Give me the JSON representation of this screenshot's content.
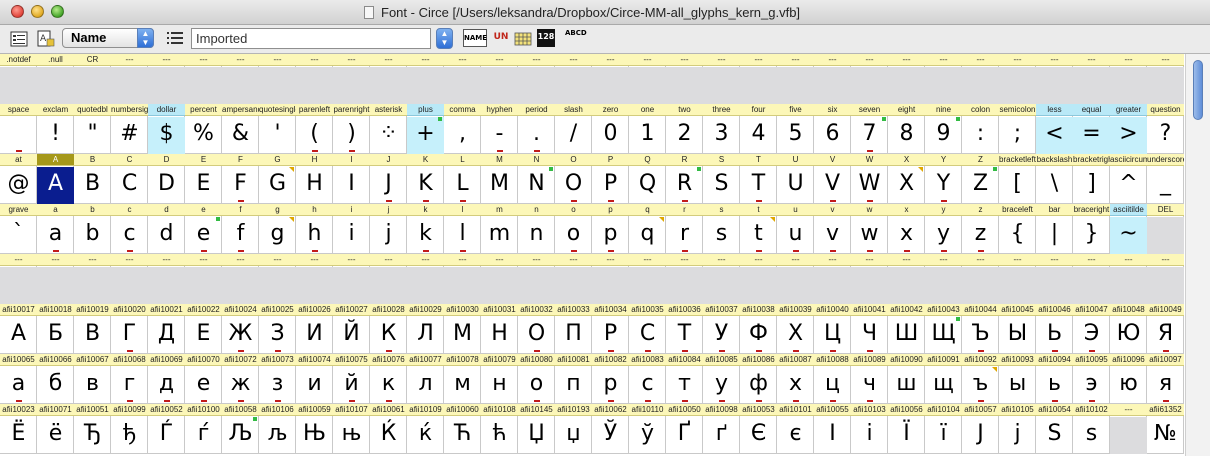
{
  "window": {
    "title": "Font - Circe [/Users/leksandra/Dropbox/Circe-MM-all_glyphs_kern_g.vfb]"
  },
  "toolbar": {
    "name_select": "Name",
    "pattern_value": "Imported",
    "view_buttons": [
      "NAME",
      "UN",
      "",
      "128",
      "ABCD"
    ]
  },
  "glyph_rows": [
    [
      {
        "n": ".notdef",
        "g": "",
        "e": 1
      },
      {
        "n": ".null",
        "g": "",
        "e": 1
      },
      {
        "n": "CR",
        "g": "",
        "e": 1
      },
      {
        "n": "---",
        "g": "",
        "e": 1
      },
      {
        "n": "---",
        "g": "",
        "e": 1
      },
      {
        "n": "---",
        "g": "",
        "e": 1
      },
      {
        "n": "---",
        "g": "",
        "e": 1
      },
      {
        "n": "---",
        "g": "",
        "e": 1
      },
      {
        "n": "---",
        "g": "",
        "e": 1
      },
      {
        "n": "---",
        "g": "",
        "e": 1
      },
      {
        "n": "---",
        "g": "",
        "e": 1
      },
      {
        "n": "---",
        "g": "",
        "e": 1
      },
      {
        "n": "---",
        "g": "",
        "e": 1
      },
      {
        "n": "---",
        "g": "",
        "e": 1
      },
      {
        "n": "---",
        "g": "",
        "e": 1
      },
      {
        "n": "---",
        "g": "",
        "e": 1
      },
      {
        "n": "---",
        "g": "",
        "e": 1
      },
      {
        "n": "---",
        "g": "",
        "e": 1
      },
      {
        "n": "---",
        "g": "",
        "e": 1
      },
      {
        "n": "---",
        "g": "",
        "e": 1
      },
      {
        "n": "---",
        "g": "",
        "e": 1
      },
      {
        "n": "---",
        "g": "",
        "e": 1
      },
      {
        "n": "---",
        "g": "",
        "e": 1
      },
      {
        "n": "---",
        "g": "",
        "e": 1
      },
      {
        "n": "---",
        "g": "",
        "e": 1
      },
      {
        "n": "---",
        "g": "",
        "e": 1
      },
      {
        "n": "---",
        "g": "",
        "e": 1
      },
      {
        "n": "---",
        "g": "",
        "e": 1
      },
      {
        "n": "---",
        "g": "",
        "e": 1
      },
      {
        "n": "---",
        "g": "",
        "e": 1
      },
      {
        "n": "---",
        "g": "",
        "e": 1
      },
      {
        "n": "---",
        "g": "",
        "e": 1
      }
    ],
    [
      {
        "n": "space",
        "g": "",
        "m": 1
      },
      {
        "n": "exclam",
        "g": "!"
      },
      {
        "n": "quotedbl",
        "g": "\""
      },
      {
        "n": "numbersign",
        "g": "#"
      },
      {
        "n": "dollar",
        "g": "$",
        "h": 1
      },
      {
        "n": "percent",
        "g": "%"
      },
      {
        "n": "ampersand",
        "g": "&"
      },
      {
        "n": "quotesingle",
        "g": "'"
      },
      {
        "n": "parenleft",
        "g": "(",
        "m": 1
      },
      {
        "n": "parenright",
        "g": ")",
        "m": 1
      },
      {
        "n": "asterisk",
        "g": "⁘"
      },
      {
        "n": "plus",
        "g": "+",
        "h": 1,
        "c": 1
      },
      {
        "n": "comma",
        "g": ","
      },
      {
        "n": "hyphen",
        "g": "-",
        "m": 1
      },
      {
        "n": "period",
        "g": ".",
        "m": 1
      },
      {
        "n": "slash",
        "g": "/"
      },
      {
        "n": "zero",
        "g": "0"
      },
      {
        "n": "one",
        "g": "1"
      },
      {
        "n": "two",
        "g": "2"
      },
      {
        "n": "three",
        "g": "3"
      },
      {
        "n": "four",
        "g": "4"
      },
      {
        "n": "five",
        "g": "5"
      },
      {
        "n": "six",
        "g": "6"
      },
      {
        "n": "seven",
        "g": "7",
        "m": 1,
        "c": 1
      },
      {
        "n": "eight",
        "g": "8"
      },
      {
        "n": "nine",
        "g": "9",
        "c": 1
      },
      {
        "n": "colon",
        "g": ":"
      },
      {
        "n": "semicolon",
        "g": ";"
      },
      {
        "n": "less",
        "g": "<",
        "h": 1
      },
      {
        "n": "equal",
        "g": "=",
        "h": 1
      },
      {
        "n": "greater",
        "g": ">",
        "h": 1
      },
      {
        "n": "question",
        "g": "?"
      }
    ],
    [
      {
        "n": "at",
        "g": "@"
      },
      {
        "n": "A",
        "g": "A",
        "s": 1
      },
      {
        "n": "B",
        "g": "B"
      },
      {
        "n": "C",
        "g": "C"
      },
      {
        "n": "D",
        "g": "D"
      },
      {
        "n": "E",
        "g": "E"
      },
      {
        "n": "F",
        "g": "F",
        "m": 1
      },
      {
        "n": "G",
        "g": "G",
        "y": 1
      },
      {
        "n": "H",
        "g": "H"
      },
      {
        "n": "I",
        "g": "I"
      },
      {
        "n": "J",
        "g": "J",
        "m": 1
      },
      {
        "n": "K",
        "g": "K",
        "m": 1
      },
      {
        "n": "L",
        "g": "L",
        "m": 1
      },
      {
        "n": "M",
        "g": "M"
      },
      {
        "n": "N",
        "g": "N",
        "c": 1
      },
      {
        "n": "O",
        "g": "O",
        "m": 1
      },
      {
        "n": "P",
        "g": "P",
        "m": 1
      },
      {
        "n": "Q",
        "g": "Q"
      },
      {
        "n": "R",
        "g": "R",
        "m": 1,
        "c": 1
      },
      {
        "n": "S",
        "g": "S"
      },
      {
        "n": "T",
        "g": "T",
        "m": 1
      },
      {
        "n": "U",
        "g": "U"
      },
      {
        "n": "V",
        "g": "V",
        "m": 1
      },
      {
        "n": "W",
        "g": "W",
        "m": 1
      },
      {
        "n": "X",
        "g": "X",
        "y": 1
      },
      {
        "n": "Y",
        "g": "Y",
        "m": 1
      },
      {
        "n": "Z",
        "g": "Z",
        "c": 1
      },
      {
        "n": "bracketleft",
        "g": "["
      },
      {
        "n": "backslash",
        "g": "\\"
      },
      {
        "n": "bracketright",
        "g": "]"
      },
      {
        "n": "asciicircum",
        "g": "^"
      },
      {
        "n": "underscore",
        "g": "_"
      }
    ],
    [
      {
        "n": "grave",
        "g": "`"
      },
      {
        "n": "a",
        "g": "a",
        "m": 1
      },
      {
        "n": "b",
        "g": "b"
      },
      {
        "n": "c",
        "g": "c",
        "m": 1
      },
      {
        "n": "d",
        "g": "d"
      },
      {
        "n": "e",
        "g": "e",
        "m": 1,
        "c": 1
      },
      {
        "n": "f",
        "g": "f",
        "m": 1
      },
      {
        "n": "g",
        "g": "g",
        "y": 1
      },
      {
        "n": "h",
        "g": "h",
        "m": 1
      },
      {
        "n": "i",
        "g": "i"
      },
      {
        "n": "j",
        "g": "j"
      },
      {
        "n": "k",
        "g": "k",
        "m": 1
      },
      {
        "n": "l",
        "g": "l",
        "m": 1
      },
      {
        "n": "m",
        "g": "m"
      },
      {
        "n": "n",
        "g": "n"
      },
      {
        "n": "o",
        "g": "o",
        "m": 1
      },
      {
        "n": "p",
        "g": "p",
        "m": 1
      },
      {
        "n": "q",
        "g": "q",
        "y": 1
      },
      {
        "n": "r",
        "g": "r",
        "m": 1
      },
      {
        "n": "s",
        "g": "s"
      },
      {
        "n": "t",
        "g": "t",
        "m": 1,
        "y": 1
      },
      {
        "n": "u",
        "g": "u",
        "m": 1
      },
      {
        "n": "v",
        "g": "v",
        "m": 1
      },
      {
        "n": "w",
        "g": "w",
        "m": 1
      },
      {
        "n": "x",
        "g": "x",
        "m": 1
      },
      {
        "n": "y",
        "g": "y",
        "m": 1
      },
      {
        "n": "z",
        "g": "z",
        "m": 1
      },
      {
        "n": "braceleft",
        "g": "{"
      },
      {
        "n": "bar",
        "g": "|"
      },
      {
        "n": "braceright",
        "g": "}"
      },
      {
        "n": "asciitilde",
        "g": "~",
        "h": 1
      },
      {
        "n": "DEL",
        "g": "",
        "e": 1
      }
    ],
    [
      {
        "n": "---",
        "g": "",
        "e": 1
      },
      {
        "n": "---",
        "g": "",
        "e": 1
      },
      {
        "n": "---",
        "g": "",
        "e": 1
      },
      {
        "n": "---",
        "g": "",
        "e": 1
      },
      {
        "n": "---",
        "g": "",
        "e": 1
      },
      {
        "n": "---",
        "g": "",
        "e": 1
      },
      {
        "n": "---",
        "g": "",
        "e": 1
      },
      {
        "n": "---",
        "g": "",
        "e": 1
      },
      {
        "n": "---",
        "g": "",
        "e": 1
      },
      {
        "n": "---",
        "g": "",
        "e": 1
      },
      {
        "n": "---",
        "g": "",
        "e": 1
      },
      {
        "n": "---",
        "g": "",
        "e": 1
      },
      {
        "n": "---",
        "g": "",
        "e": 1
      },
      {
        "n": "---",
        "g": "",
        "e": 1
      },
      {
        "n": "---",
        "g": "",
        "e": 1
      },
      {
        "n": "---",
        "g": "",
        "e": 1
      },
      {
        "n": "---",
        "g": "",
        "e": 1
      },
      {
        "n": "---",
        "g": "",
        "e": 1
      },
      {
        "n": "---",
        "g": "",
        "e": 1
      },
      {
        "n": "---",
        "g": "",
        "e": 1
      },
      {
        "n": "---",
        "g": "",
        "e": 1
      },
      {
        "n": "---",
        "g": "",
        "e": 1
      },
      {
        "n": "---",
        "g": "",
        "e": 1
      },
      {
        "n": "---",
        "g": "",
        "e": 1
      },
      {
        "n": "---",
        "g": "",
        "e": 1
      },
      {
        "n": "---",
        "g": "",
        "e": 1
      },
      {
        "n": "---",
        "g": "",
        "e": 1
      },
      {
        "n": "---",
        "g": "",
        "e": 1
      },
      {
        "n": "---",
        "g": "",
        "e": 1
      },
      {
        "n": "---",
        "g": "",
        "e": 1
      },
      {
        "n": "---",
        "g": "",
        "e": 1
      },
      {
        "n": "---",
        "g": "",
        "e": 1
      }
    ],
    [
      {
        "n": "afii10017",
        "g": "А"
      },
      {
        "n": "afii10018",
        "g": "Б"
      },
      {
        "n": "afii10019",
        "g": "В"
      },
      {
        "n": "afii10020",
        "g": "Г",
        "m": 1
      },
      {
        "n": "afii10021",
        "g": "Д"
      },
      {
        "n": "afii10022",
        "g": "Е"
      },
      {
        "n": "afii10024",
        "g": "Ж",
        "m": 1
      },
      {
        "n": "afii10025",
        "g": "З",
        "m": 1
      },
      {
        "n": "afii10026",
        "g": "И"
      },
      {
        "n": "afii10027",
        "g": "Й"
      },
      {
        "n": "afii10028",
        "g": "К",
        "m": 1
      },
      {
        "n": "afii10029",
        "g": "Л"
      },
      {
        "n": "afii10030",
        "g": "М"
      },
      {
        "n": "afii10031",
        "g": "Н"
      },
      {
        "n": "afii10032",
        "g": "О",
        "m": 1
      },
      {
        "n": "afii10033",
        "g": "П"
      },
      {
        "n": "afii10034",
        "g": "Р",
        "m": 1
      },
      {
        "n": "afii10035",
        "g": "С",
        "m": 1
      },
      {
        "n": "afii10036",
        "g": "Т",
        "m": 1
      },
      {
        "n": "afii10037",
        "g": "У",
        "m": 1
      },
      {
        "n": "afii10038",
        "g": "Ф",
        "m": 1
      },
      {
        "n": "afii10039",
        "g": "Х",
        "m": 1
      },
      {
        "n": "afii10040",
        "g": "Ц",
        "m": 1
      },
      {
        "n": "afii10041",
        "g": "Ч",
        "m": 1
      },
      {
        "n": "afii10042",
        "g": "Ш"
      },
      {
        "n": "afii10043",
        "g": "Щ",
        "c": 1
      },
      {
        "n": "afii10044",
        "g": "Ъ",
        "m": 1
      },
      {
        "n": "afii10045",
        "g": "Ы"
      },
      {
        "n": "afii10046",
        "g": "Ь",
        "m": 1
      },
      {
        "n": "afii10047",
        "g": "Э",
        "m": 1
      },
      {
        "n": "afii10048",
        "g": "Ю"
      },
      {
        "n": "afii10049",
        "g": "Я",
        "m": 1
      }
    ],
    [
      {
        "n": "afii10065",
        "g": "а",
        "m": 1
      },
      {
        "n": "afii10066",
        "g": "б"
      },
      {
        "n": "afii10067",
        "g": "в"
      },
      {
        "n": "afii10068",
        "g": "г",
        "m": 1
      },
      {
        "n": "afii10069",
        "g": "д",
        "m": 1
      },
      {
        "n": "afii10070",
        "g": "е",
        "m": 1
      },
      {
        "n": "afii10072",
        "g": "ж",
        "m": 1
      },
      {
        "n": "afii10073",
        "g": "з",
        "m": 1
      },
      {
        "n": "afii10074",
        "g": "и"
      },
      {
        "n": "afii10075",
        "g": "й",
        "m": 1
      },
      {
        "n": "afii10076",
        "g": "к",
        "m": 1
      },
      {
        "n": "afii10077",
        "g": "л"
      },
      {
        "n": "afii10078",
        "g": "м"
      },
      {
        "n": "afii10079",
        "g": "н"
      },
      {
        "n": "afii10080",
        "g": "о",
        "m": 1
      },
      {
        "n": "afii10081",
        "g": "п"
      },
      {
        "n": "afii10082",
        "g": "р",
        "m": 1
      },
      {
        "n": "afii10083",
        "g": "с",
        "m": 1
      },
      {
        "n": "afii10084",
        "g": "т",
        "m": 1
      },
      {
        "n": "afii10085",
        "g": "у",
        "m": 1
      },
      {
        "n": "afii10086",
        "g": "ф",
        "m": 1
      },
      {
        "n": "afii10087",
        "g": "х",
        "m": 1
      },
      {
        "n": "afii10088",
        "g": "ц",
        "m": 1
      },
      {
        "n": "afii10089",
        "g": "ч",
        "m": 1
      },
      {
        "n": "afii10090",
        "g": "ш"
      },
      {
        "n": "afii10091",
        "g": "щ"
      },
      {
        "n": "afii10092",
        "g": "ъ",
        "m": 1,
        "y": 1
      },
      {
        "n": "afii10093",
        "g": "ы"
      },
      {
        "n": "afii10094",
        "g": "ь",
        "m": 1
      },
      {
        "n": "afii10095",
        "g": "э",
        "m": 1
      },
      {
        "n": "afii10096",
        "g": "ю"
      },
      {
        "n": "afii10097",
        "g": "я",
        "m": 1
      }
    ],
    [
      {
        "n": "afii10023",
        "g": "Ё"
      },
      {
        "n": "afii10071",
        "g": "ё"
      },
      {
        "n": "afii10051",
        "g": "Ђ"
      },
      {
        "n": "afii10099",
        "g": "ђ"
      },
      {
        "n": "afii10052",
        "g": "Ѓ"
      },
      {
        "n": "afii10100",
        "g": "ѓ"
      },
      {
        "n": "afii10058",
        "g": "Љ",
        "c": 1
      },
      {
        "n": "afii10106",
        "g": "љ"
      },
      {
        "n": "afii10059",
        "g": "Њ"
      },
      {
        "n": "afii10107",
        "g": "њ"
      },
      {
        "n": "afii10061",
        "g": "Ќ"
      },
      {
        "n": "afii10109",
        "g": "ќ"
      },
      {
        "n": "afii10060",
        "g": "Ћ"
      },
      {
        "n": "afii10108",
        "g": "ћ"
      },
      {
        "n": "afii10145",
        "g": "Џ"
      },
      {
        "n": "afii10193",
        "g": "џ"
      },
      {
        "n": "afii10062",
        "g": "Ў"
      },
      {
        "n": "afii10110",
        "g": "ў"
      },
      {
        "n": "afii10050",
        "g": "Ґ"
      },
      {
        "n": "afii10098",
        "g": "ґ"
      },
      {
        "n": "afii10053",
        "g": "Є"
      },
      {
        "n": "afii10101",
        "g": "є"
      },
      {
        "n": "afii10055",
        "g": "І"
      },
      {
        "n": "afii10103",
        "g": "і"
      },
      {
        "n": "afii10056",
        "g": "Ї"
      },
      {
        "n": "afii10104",
        "g": "ї"
      },
      {
        "n": "afii10057",
        "g": "Ј"
      },
      {
        "n": "afii10105",
        "g": "ј"
      },
      {
        "n": "afii10054",
        "g": "Ѕ"
      },
      {
        "n": "afii10102",
        "g": "ѕ"
      },
      {
        "n": "---",
        "g": "",
        "e": 1
      },
      {
        "n": "afii61352",
        "g": "№"
      }
    ]
  ]
}
